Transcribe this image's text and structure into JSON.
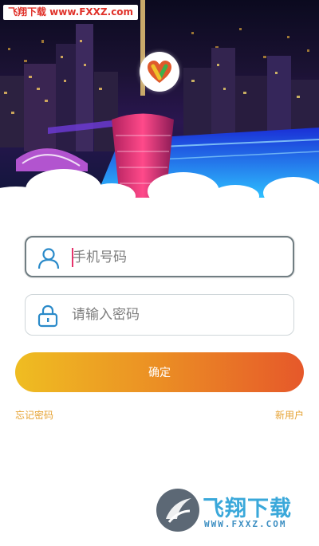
{
  "watermark_top": "飞翔下载 www.FXXZ.com",
  "login": {
    "phone_placeholder": "手机号码",
    "password_placeholder": "请输入密码",
    "confirm_label": "确定",
    "forgot_label": "忘记密码",
    "register_label": "新用户"
  },
  "watermark_bottom": {
    "title": "飞翔下载",
    "url": "WWW.FXXZ.COM"
  },
  "colors": {
    "accent_gradient_start": "#efbd22",
    "accent_gradient_end": "#e6582a",
    "link": "#e6a232",
    "icon_blue": "#2a8ac9",
    "caret": "#e6336b"
  },
  "icons": {
    "logo": "heart-v-logo-icon",
    "phone_field": "user-icon",
    "password_field": "lock-icon"
  }
}
